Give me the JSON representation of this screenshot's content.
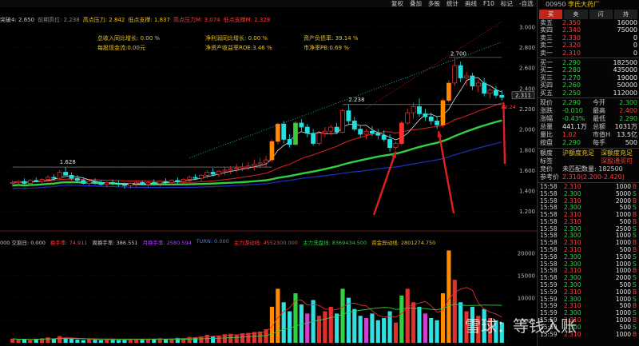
{
  "menu": [
    "复权",
    "叠加",
    "多股",
    "统计",
    "画线",
    "F10",
    "标记",
    "-自选",
    "返回"
  ],
  "indicators": [
    {
      "text": "突破4: 2.650",
      "color": "#c8c8c8"
    },
    {
      "text": "前期高位: 2.238",
      "color": "#888888"
    },
    {
      "text": "高点压力: 2.842",
      "color": "#e8c020"
    },
    {
      "text": "低点支撑: 1.837",
      "color": "#e8c020"
    },
    {
      "text": "高点压力M: 3.074",
      "color": "#ff3c3c"
    },
    {
      "text": "低点支撑M: 2.328",
      "color": "#ff3c3c"
    }
  ],
  "fundamentals": {
    "rev_growth": "总收入同比增长: 0.00 %",
    "cash_flow": "每股现金流:0.00元",
    "profit_growth": "净利润同比增长: 0.00 %",
    "roe": "净资产收益率ROE:3.46 %",
    "debt_ratio": "资产负债率: 39.14 %",
    "pb": "市净率PB:0.69 %"
  },
  "price_axis": {
    "ticks": [
      "3.000",
      "2.800",
      "2.600",
      "2.400",
      "2.200",
      "2.000",
      "1.800",
      "1.600",
      "1.400",
      "1.200"
    ],
    "current": "2.311"
  },
  "volume_axis": {
    "ticks": [
      "20000",
      "15000",
      "10000",
      "5000"
    ]
  },
  "labels": {
    "low1": "1.628",
    "mid": "2.238",
    "high": "2.700",
    "right": "2.24"
  },
  "volume_header": [
    {
      "text": "000 交割日: 0.000",
      "color": "#c8c8c8"
    },
    {
      "text": "换手率: 74.911",
      "color": "#ff3c3c"
    },
    {
      "text": "周换手率: 386.551",
      "color": "#c8c8c8"
    },
    {
      "text": "月换手率: 2580.594",
      "color": "#b040ff"
    },
    {
      "text": "TURN: 0.000",
      "color": "#4080ff"
    },
    {
      "text": "主力游动线: 4552300.000",
      "color": "#ff3c3c"
    },
    {
      "text": "主力洗盘线: 8369434.500",
      "color": "#2ecc40"
    },
    {
      "text": "资金异动线: 2801274.750",
      "color": "#e8c020"
    }
  ],
  "stock": {
    "code": "00950",
    "name": "李氏大药厂"
  },
  "buttons": [
    "买",
    "卖",
    "闪",
    "持"
  ],
  "asks": [
    {
      "label": "卖五",
      "price": "2.350",
      "vol": "16000",
      "color": "#ff3c3c"
    },
    {
      "label": "卖四",
      "price": "2.340",
      "vol": "75000",
      "color": "#ff3c3c"
    },
    {
      "label": "卖三",
      "price": "2.330",
      "vol": "0",
      "color": "#ff3c3c"
    },
    {
      "label": "卖二",
      "price": "2.320",
      "vol": "0",
      "color": "#ff3c3c"
    },
    {
      "label": "卖一",
      "price": "2.310",
      "vol": "0",
      "color": "#ff3c3c"
    }
  ],
  "bids": [
    {
      "label": "买一",
      "price": "2.290",
      "vol": "182500",
      "color": "#2ecc40"
    },
    {
      "label": "买二",
      "price": "2.280",
      "vol": "435000",
      "color": "#2ecc40"
    },
    {
      "label": "买三",
      "price": "2.270",
      "vol": "19000",
      "color": "#2ecc40"
    },
    {
      "label": "买四",
      "price": "2.260",
      "vol": "50000",
      "color": "#2ecc40"
    },
    {
      "label": "买五",
      "price": "2.250",
      "vol": "112000",
      "color": "#2ecc40"
    }
  ],
  "stats": [
    {
      "k": "现价",
      "v": "2.290",
      "vc": "#2ecc40",
      "k2": "今开",
      "v2": "2.300",
      "v2c": "#2ecc40"
    },
    {
      "k": "涨跌",
      "v": "-0.010",
      "vc": "#2ecc40",
      "k2": "最高",
      "v2": "2.400",
      "v2c": "#ff3c3c"
    },
    {
      "k": "涨幅",
      "v": "-0.43%",
      "vc": "#2ecc40",
      "k2": "最低",
      "v2": "2.290",
      "v2c": "#2ecc40"
    },
    {
      "k": "总量",
      "v": "441.1万",
      "vc": "#e8e8e8",
      "k2": "总额",
      "v2": "1031万",
      "v2c": "#e8e8e8"
    },
    {
      "k": "量比",
      "v": "1.02",
      "vc": "#ff3c3c",
      "k2": "市值H",
      "v2": "13.5亿",
      "v2c": "#e8e8e8"
    },
    {
      "k": "按盘",
      "v": "2.290",
      "vc": "#2ecc40",
      "k2": "每手",
      "v2": "500",
      "v2c": "#e8e8e8"
    }
  ],
  "quota": {
    "label": "额度",
    "shanghai": "沪额度充足",
    "shenzhen": "深额度充足"
  },
  "mkt": {
    "label": "标签",
    "value": "深股通买可"
  },
  "auction": {
    "label": "竞价",
    "value": "未匹配数量: 182500"
  },
  "ref": {
    "label": "参考价",
    "value": "2.310(2.200-2.420)"
  },
  "ticks": [
    {
      "t": "15:58",
      "p": "2.310",
      "pc": "#ff3c3c",
      "n": "1000",
      "d": "B",
      "dc": "#ff3c3c"
    },
    {
      "t": "15:58",
      "p": "2.300",
      "pc": "#2ecc40",
      "n": "5000",
      "d": "S",
      "dc": "#2ecc40"
    },
    {
      "t": "15:58",
      "p": "2.310",
      "pc": "#ff3c3c",
      "n": "2000",
      "d": "B",
      "dc": "#ff3c3c"
    },
    {
      "t": "15:58",
      "p": "2.300",
      "pc": "#2ecc40",
      "n": "500",
      "d": "S",
      "dc": "#2ecc40"
    },
    {
      "t": "15:58",
      "p": "2.310",
      "pc": "#ff3c3c",
      "n": "1000",
      "d": "B",
      "dc": "#ff3c3c"
    },
    {
      "t": "15:58",
      "p": "2.310",
      "pc": "#ff3c3c",
      "n": "500",
      "d": "B",
      "dc": "#ff3c3c"
    },
    {
      "t": "15:58",
      "p": "2.300",
      "pc": "#2ecc40",
      "n": "2500",
      "d": "S",
      "dc": "#2ecc40"
    },
    {
      "t": "15:58",
      "p": "2.300",
      "pc": "#2ecc40",
      "n": "1000",
      "d": "S",
      "dc": "#2ecc40"
    },
    {
      "t": "15:58",
      "p": "2.310",
      "pc": "#ff3c3c",
      "n": "1000",
      "d": "B",
      "dc": "#ff3c3c"
    },
    {
      "t": "15:58",
      "p": "2.310",
      "pc": "#ff3c3c",
      "n": "500",
      "d": "B",
      "dc": "#ff3c3c"
    },
    {
      "t": "15:58",
      "p": "2.300",
      "pc": "#2ecc40",
      "n": "1500",
      "d": "S",
      "dc": "#2ecc40"
    },
    {
      "t": "15:58",
      "p": "2.300",
      "pc": "#2ecc40",
      "n": "1000",
      "d": "S",
      "dc": "#2ecc40"
    },
    {
      "t": "15:58",
      "p": "2.310",
      "pc": "#ff3c3c",
      "n": "1000",
      "d": "B",
      "dc": "#ff3c3c"
    },
    {
      "t": "15:58",
      "p": "2.300",
      "pc": "#2ecc40",
      "n": "2000",
      "d": "S",
      "dc": "#2ecc40"
    },
    {
      "t": "15:59",
      "p": "2.300",
      "pc": "#2ecc40",
      "n": "500",
      "d": "S",
      "dc": "#2ecc40"
    },
    {
      "t": "15:59",
      "p": "2.310",
      "pc": "#ff3c3c",
      "n": "1000",
      "d": "B",
      "dc": "#ff3c3c"
    },
    {
      "t": "15:59",
      "p": "2.300",
      "pc": "#2ecc40",
      "n": "1000",
      "d": "S",
      "dc": "#2ecc40"
    },
    {
      "t": "15:59",
      "p": "2.310",
      "pc": "#ff3c3c",
      "n": "500",
      "d": "B",
      "dc": "#ff3c3c"
    },
    {
      "t": "15:59",
      "p": "2.300",
      "pc": "#2ecc40",
      "n": "1000",
      "d": "S",
      "dc": "#2ecc40"
    },
    {
      "t": "15:59",
      "p": "2.310",
      "pc": "#ff3c3c",
      "n": "1000",
      "d": "B",
      "dc": "#ff3c3c"
    },
    {
      "t": "15:59",
      "p": "2.300",
      "pc": "#2ecc40",
      "n": "500",
      "d": "S",
      "dc": "#2ecc40"
    },
    {
      "t": "15:59",
      "p": "2.310",
      "pc": "#ff3c3c",
      "n": "1000",
      "d": "B",
      "dc": "#ff3c3c"
    }
  ],
  "watermark": "雪球：等钱入账",
  "chart_data": {
    "type": "candlestick",
    "ylim": [
      1.1,
      3.05
    ],
    "candles": [
      [
        1.47,
        1.5,
        1.44,
        1.48
      ],
      [
        1.48,
        1.5,
        1.45,
        1.49
      ],
      [
        1.49,
        1.52,
        1.46,
        1.47
      ],
      [
        1.47,
        1.51,
        1.45,
        1.5
      ],
      [
        1.5,
        1.53,
        1.48,
        1.49
      ],
      [
        1.49,
        1.52,
        1.47,
        1.51
      ],
      [
        1.51,
        1.55,
        1.49,
        1.53
      ],
      [
        1.53,
        1.56,
        1.5,
        1.52
      ],
      [
        1.52,
        1.6,
        1.5,
        1.58
      ],
      [
        1.58,
        1.63,
        1.55,
        1.55
      ],
      [
        1.55,
        1.58,
        1.5,
        1.52
      ],
      [
        1.52,
        1.55,
        1.48,
        1.5
      ],
      [
        1.5,
        1.53,
        1.46,
        1.47
      ],
      [
        1.47,
        1.5,
        1.44,
        1.49
      ],
      [
        1.49,
        1.52,
        1.46,
        1.48
      ],
      [
        1.48,
        1.5,
        1.45,
        1.46
      ],
      [
        1.46,
        1.49,
        1.43,
        1.48
      ],
      [
        1.48,
        1.51,
        1.45,
        1.47
      ],
      [
        1.47,
        1.5,
        1.44,
        1.46
      ],
      [
        1.46,
        1.48,
        1.42,
        1.45
      ],
      [
        1.45,
        1.48,
        1.42,
        1.47
      ],
      [
        1.47,
        1.5,
        1.44,
        1.48
      ],
      [
        1.48,
        1.5,
        1.45,
        1.46
      ],
      [
        1.46,
        1.49,
        1.43,
        1.48
      ],
      [
        1.48,
        1.51,
        1.45,
        1.47
      ],
      [
        1.47,
        1.5,
        1.44,
        1.49
      ],
      [
        1.49,
        1.52,
        1.46,
        1.48
      ],
      [
        1.48,
        1.51,
        1.45,
        1.5
      ],
      [
        1.5,
        1.53,
        1.47,
        1.49
      ],
      [
        1.49,
        1.52,
        1.46,
        1.51
      ],
      [
        1.51,
        1.55,
        1.48,
        1.53
      ],
      [
        1.53,
        1.56,
        1.5,
        1.52
      ],
      [
        1.52,
        1.56,
        1.49,
        1.55
      ],
      [
        1.55,
        1.6,
        1.52,
        1.58
      ],
      [
        1.58,
        1.62,
        1.54,
        1.56
      ],
      [
        1.56,
        1.6,
        1.53,
        1.59
      ],
      [
        1.59,
        1.63,
        1.55,
        1.6
      ],
      [
        1.6,
        1.64,
        1.56,
        1.61
      ],
      [
        1.61,
        1.66,
        1.58,
        1.62
      ],
      [
        1.62,
        1.67,
        1.59,
        1.63
      ],
      [
        1.63,
        1.68,
        1.6,
        1.64
      ],
      [
        1.64,
        1.7,
        1.6,
        1.66
      ],
      [
        1.66,
        1.72,
        1.62,
        1.67
      ],
      [
        1.67,
        1.74,
        1.63,
        1.7
      ],
      [
        1.7,
        1.9,
        1.68,
        1.88
      ],
      [
        1.88,
        2.06,
        1.85,
        2.05
      ],
      [
        2.05,
        2.08,
        1.86,
        1.9
      ],
      [
        1.9,
        1.95,
        1.82,
        1.85
      ],
      [
        1.85,
        2.08,
        1.84,
        2.06
      ],
      [
        2.06,
        2.1,
        1.98,
        2.02
      ],
      [
        2.02,
        2.05,
        1.92,
        1.96
      ],
      [
        1.96,
        2.0,
        1.84,
        1.86
      ],
      [
        1.86,
        1.98,
        1.84,
        1.96
      ],
      [
        1.96,
        2.02,
        1.92,
        1.98
      ],
      [
        1.98,
        2.04,
        1.94,
        2.02
      ],
      [
        2.02,
        2.06,
        1.95,
        1.97
      ],
      [
        1.97,
        2.2,
        1.96,
        2.18
      ],
      [
        2.18,
        2.24,
        2.05,
        2.08
      ],
      [
        2.08,
        2.12,
        1.98,
        2.0
      ],
      [
        2.0,
        2.04,
        1.92,
        1.95
      ],
      [
        1.95,
        2.0,
        1.9,
        1.98
      ],
      [
        1.98,
        2.03,
        1.93,
        1.96
      ],
      [
        1.96,
        2.0,
        1.9,
        1.94
      ],
      [
        1.94,
        1.99,
        1.88,
        1.9
      ],
      [
        1.9,
        1.95,
        1.78,
        1.82
      ],
      [
        1.82,
        1.88,
        1.8,
        1.86
      ],
      [
        1.86,
        2.08,
        1.84,
        2.06
      ],
      [
        2.06,
        2.2,
        2.04,
        2.16
      ],
      [
        2.16,
        2.26,
        2.1,
        2.22
      ],
      [
        2.22,
        2.3,
        2.12,
        2.15
      ],
      [
        2.15,
        2.2,
        2.08,
        2.12
      ],
      [
        2.12,
        2.16,
        2.04,
        2.08
      ],
      [
        2.08,
        2.12,
        2.0,
        2.04
      ],
      [
        2.04,
        2.3,
        2.02,
        2.28
      ],
      [
        2.28,
        2.48,
        2.26,
        2.45
      ],
      [
        2.45,
        2.7,
        2.42,
        2.62
      ],
      [
        2.62,
        2.66,
        2.46,
        2.5
      ],
      [
        2.5,
        2.56,
        2.42,
        2.52
      ],
      [
        2.52,
        2.55,
        2.38,
        2.42
      ],
      [
        2.42,
        2.48,
        2.36,
        2.45
      ],
      [
        2.45,
        2.5,
        2.32,
        2.35
      ],
      [
        2.35,
        2.4,
        2.3,
        2.38
      ],
      [
        2.38,
        2.42,
        2.3,
        2.33
      ],
      [
        2.33,
        2.38,
        2.28,
        2.31
      ]
    ],
    "volume_max": 22000,
    "volumes": [
      900,
      700,
      800,
      600,
      900,
      1000,
      1200,
      800,
      1500,
      1100,
      900,
      700,
      600,
      800,
      700,
      600,
      800,
      700,
      600,
      700,
      900,
      800,
      700,
      800,
      900,
      1000,
      800,
      900,
      1100,
      1000,
      1300,
      1200,
      1400,
      1800,
      1500,
      1600,
      1900,
      2000,
      1800,
      2100,
      2200,
      2400,
      2500,
      3000,
      8000,
      12000,
      9000,
      7000,
      11000,
      8500,
      6500,
      9500,
      6000,
      7000,
      8000,
      6500,
      12000,
      10000,
      7500,
      6000,
      5500,
      6500,
      5000,
      5500,
      7000,
      4500,
      10500,
      12000,
      9000,
      8000,
      6500,
      5500,
      5000,
      11000,
      20500,
      14000,
      9000,
      7000,
      8000,
      6000,
      7500,
      5500,
      5000,
      4500
    ]
  }
}
